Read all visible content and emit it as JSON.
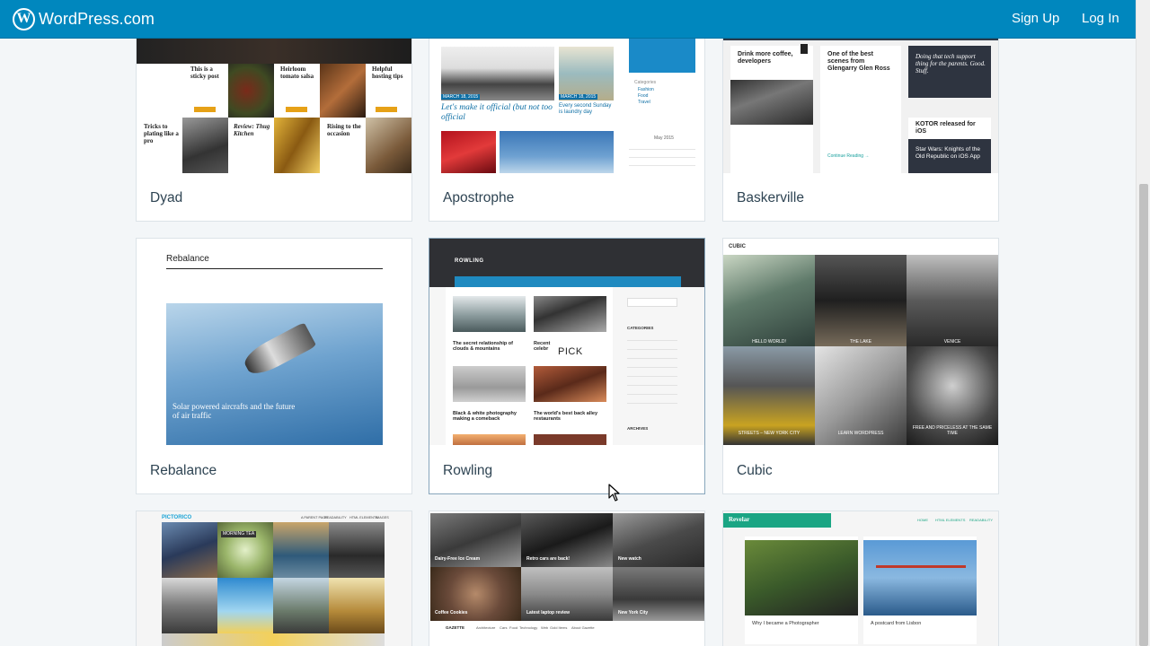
{
  "masterbar": {
    "brand": "WordPress.com",
    "logo_glyph": "W",
    "signup_label": "Sign Up",
    "login_label": "Log In",
    "background_color": "#0087be"
  },
  "themes": [
    {
      "name": "Dyad",
      "preview": {
        "posts": [
          "This is a sticky post",
          "Heirloom tomato salsa",
          "Helpful hosting tips",
          "Tricks to plating like a pro",
          "Review: Thug Kitchen",
          "Rising to the occasion"
        ]
      }
    },
    {
      "name": "Apostrophe",
      "preview": {
        "headline": "Let's make it official (but not too official",
        "caption": "Every second Sunday is laundry day",
        "date_1": "MARCH 18, 2015",
        "date_2": "MARCH 18, 2015",
        "categories_heading": "Categories",
        "categories": [
          "Fashion",
          "Food",
          "Travel"
        ],
        "calendar_month": "May 2015"
      }
    },
    {
      "name": "Baskerville",
      "preview": {
        "post_1": "Drink more coffee, developers",
        "post_2": "One of the best scenes from Glengarry Glen Ross",
        "post_3": "Doing that tech support thing for the parents. Good. Stuff.",
        "post_4": "KOTOR released for iOS",
        "post_5": "Star Wars: Knights of the Old Republic on iOS App",
        "continue": "Continue Reading →"
      }
    },
    {
      "name": "Rebalance",
      "preview": {
        "site_title": "Rebalance",
        "feature_title": "Solar powered aircrafts and the future of air traffic"
      }
    },
    {
      "name": "Rowling",
      "overlay_label": "PICK",
      "preview": {
        "site_title": "ROWLING",
        "post_1": "The secret relationship of clouds & mountains",
        "post_2": "Recent celebr",
        "post_3": "Black & white photography making a comeback",
        "post_4": "The world's best back alley restaurants",
        "categories_heading": "CATEGORIES",
        "archives_heading": "ARCHIVES"
      }
    },
    {
      "name": "Cubic",
      "preview": {
        "site_title": "CUBIC",
        "tile_labels": [
          "HELLO WORLD!",
          "THE LAKE",
          "VENICE",
          "STREETS – NEW YORK CITY",
          "LEARN WORDPRESS",
          "FREE AND PRICELESS AT THE SAME TIME"
        ]
      }
    },
    {
      "name": "Pictorico",
      "preview": {
        "site_title": "PICTORICO",
        "tile_label": "MORNING TEA",
        "menu": [
          "A PARENT PAGE",
          "READABILITY",
          "HTML ELEMENTS",
          "IMAGES"
        ]
      }
    },
    {
      "name": "Gazette",
      "preview": {
        "tiles": [
          "Dairy-Free Ice Cream",
          "Retro cars are back!",
          "New watch",
          "Coffee Cookies",
          "Latest laptop review",
          "New York City"
        ],
        "site_title": "GAZETTE",
        "menu": [
          "Architecture",
          "Cars",
          "Food",
          "Technology",
          "Web",
          "Gold Items",
          "About Gazette"
        ]
      }
    },
    {
      "name": "Revelar",
      "preview": {
        "site_title": "Revelar",
        "post_1": "Why I became a Photographer",
        "post_2": "A postcard from Lisbon",
        "menu": [
          "HOME",
          "HTML ELEMENTS",
          "READABILITY"
        ]
      }
    }
  ]
}
